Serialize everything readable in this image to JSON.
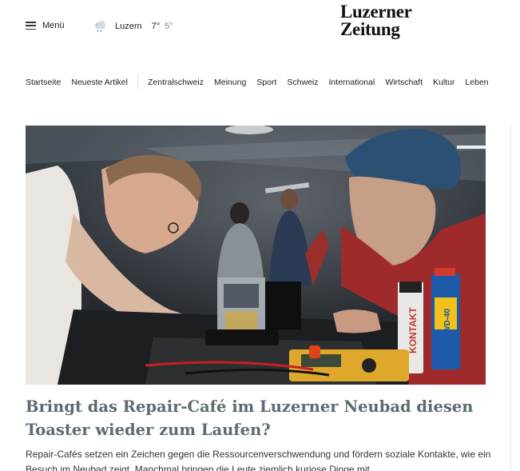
{
  "header": {
    "menu_label": "Menü",
    "menu_icon": "hamburger-icon",
    "weather": {
      "icon": "cloud-rain-icon",
      "city": "Luzern",
      "temp_max": "7°",
      "temp_min": "5°"
    },
    "logo_line1": "Luzerner",
    "logo_line2": "Zeitung"
  },
  "nav": {
    "primary": [
      "Startseite",
      "Neueste Artikel"
    ],
    "sections": [
      "Zentralschweiz",
      "Meinung",
      "Sport",
      "Schweiz",
      "International",
      "Wirtschaft",
      "Kultur",
      "Leben"
    ]
  },
  "article": {
    "headline": "Bringt das Repair-Café im Luzerner Neubad diesen Toaster wieder zum Laufen?",
    "lead": "Repair-Cafés setzen ein Zeichen gegen die Ressourcenverschwendung und fördern soziale Kontakte, wie ein Besuch im Neubad zeigt. Manchmal bringen die Leute ziemlich kuriose Dinge mit.",
    "image_text": {
      "can_left": "KONTAKT",
      "can_right": "WD-40"
    }
  },
  "colors": {
    "headline": "#5c6b72",
    "text": "#1a1a1a",
    "hat": "#2c4f74",
    "sweater": "#9e2a2c"
  }
}
